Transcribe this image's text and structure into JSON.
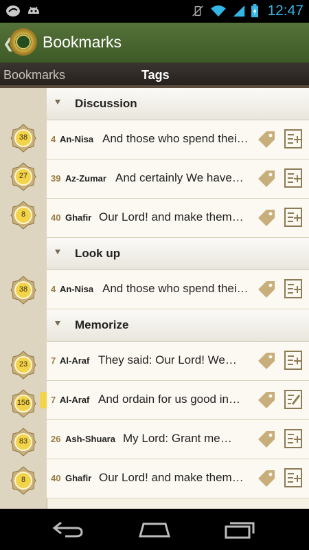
{
  "status_bar": {
    "time": "12:47",
    "accent": "#33b5e5"
  },
  "app_bar": {
    "title": "Bookmarks",
    "brand_color": "#4a6631"
  },
  "tabs": [
    {
      "label": "Bookmarks",
      "selected": false
    },
    {
      "label": "Tags",
      "selected": true
    }
  ],
  "groups": [
    {
      "name": "Discussion"
    },
    {
      "name": "Look up"
    },
    {
      "name": "Memorize"
    }
  ],
  "rows": [
    {
      "page": "38",
      "sura_num": "4",
      "sura_name": "An-Nisa",
      "verse": "And those who spend thei…"
    },
    {
      "page": "27",
      "sura_num": "39",
      "sura_name": "Az-Zumar",
      "verse": "And certainly We have…"
    },
    {
      "page": "8",
      "sura_num": "40",
      "sura_name": "Ghafir",
      "verse": "Our Lord! and make them…"
    },
    {
      "page": "38",
      "sura_num": "4",
      "sura_name": "An-Nisa",
      "verse": "And those who spend thei…"
    },
    {
      "page": "23",
      "sura_num": "7",
      "sura_name": "Al-Araf",
      "verse": "They said: Our Lord! We…"
    },
    {
      "page": "156",
      "sura_num": "7",
      "sura_name": "Al-Araf",
      "verse": "And ordain for us good in…"
    },
    {
      "page": "83",
      "sura_num": "26",
      "sura_name": "Ash-Shuara",
      "verse": "My Lord: Grant me…"
    },
    {
      "page": "8",
      "sura_num": "40",
      "sura_name": "Ghafir",
      "verse": "Our Lord! and make them…"
    }
  ],
  "icons": [
    "back-chevron-icon",
    "quran-logo-icon",
    "tag-icon",
    "note-add-icon",
    "back-nav-icon",
    "home-nav-icon",
    "recents-nav-icon"
  ]
}
